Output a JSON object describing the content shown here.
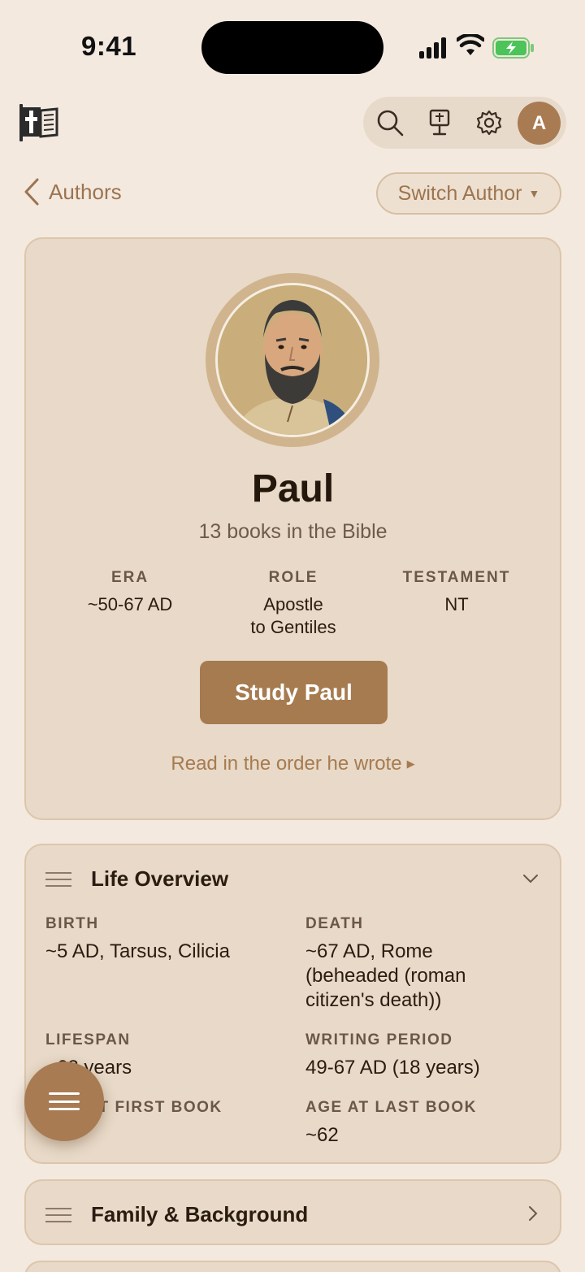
{
  "status_bar": {
    "time": "9:41"
  },
  "nav": {
    "back_label": "Authors",
    "switch_label": "Switch Author"
  },
  "toolbar": {
    "avatar_initial": "A",
    "icons": [
      "search-icon",
      "podium-icon",
      "gear-icon"
    ]
  },
  "author": {
    "name": "Paul",
    "subtitle": "13 books in the Bible",
    "stats": [
      {
        "label": "ERA",
        "value": "~50-67 AD"
      },
      {
        "label": "ROLE",
        "value": "Apostle\nto Gentiles"
      },
      {
        "label": "TESTAMENT",
        "value": "NT"
      }
    ],
    "study_button": "Study Paul",
    "read_order_link": "Read in the order he wrote"
  },
  "life_overview": {
    "title": "Life Overview",
    "fields": [
      {
        "label": "BIRTH",
        "value": "~5 AD, Tarsus, Cilicia"
      },
      {
        "label": "DEATH",
        "value": "~67 AD, Rome (beheaded (roman citizen's death))"
      },
      {
        "label": "LIFESPAN",
        "value": "~62 years"
      },
      {
        "label": "WRITING PERIOD",
        "value": "49-67 AD (18 years)"
      },
      {
        "label": "AGE AT FIRST BOOK",
        "value": ""
      },
      {
        "label": "AGE AT LAST BOOK",
        "value": "~62"
      }
    ]
  },
  "family_background": {
    "title": "Family & Background"
  },
  "colors": {
    "accent": "#a67b50",
    "background": "#f3e9df",
    "card": "#e8d9c8"
  }
}
